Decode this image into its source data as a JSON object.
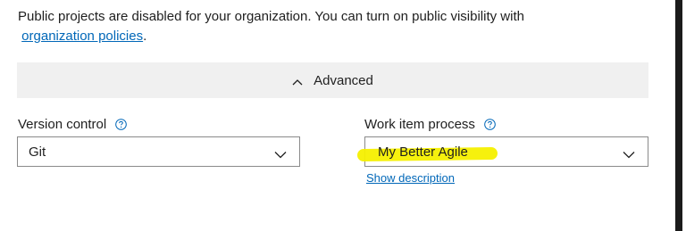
{
  "notice": {
    "text_before_link": "Public projects are disabled for your organization. You can turn on public visibility with",
    "link_text": "organization policies",
    "text_after_link": "."
  },
  "advanced": {
    "label": "Advanced",
    "icon": "chevron-up-icon"
  },
  "version_control": {
    "label": "Version control",
    "help_icon": "help-circle-icon",
    "value": "Git",
    "caret_icon": "chevron-down-icon"
  },
  "work_item_process": {
    "label": "Work item process",
    "help_icon": "help-circle-icon",
    "value": "My Better Agile",
    "caret_icon": "chevron-down-icon",
    "show_description_label": "Show description",
    "highlight_color": "#f6f000"
  },
  "colors": {
    "link": "#0067b8",
    "advanced_bar_bg": "#f0f0f0",
    "scrollbar_thumb": "#1b1b1b"
  }
}
